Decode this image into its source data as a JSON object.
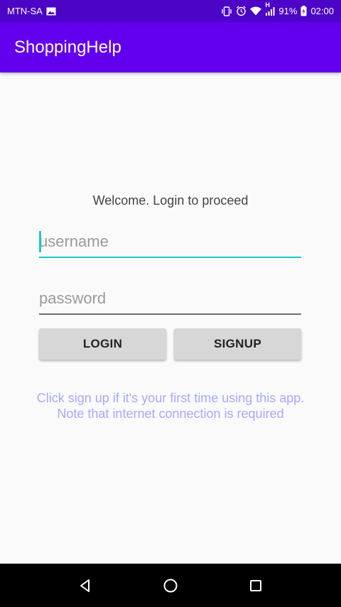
{
  "status_bar": {
    "carrier": "MTN-SA",
    "battery_percent": "91%",
    "time": "02:00",
    "network_type": "H",
    "icons": [
      "image-icon",
      "vibrate-icon",
      "alarm-icon",
      "wifi-icon",
      "signal-icon",
      "battery-charging-icon"
    ]
  },
  "app_bar": {
    "title": "ShoppingHelp",
    "color": "#6200ee"
  },
  "login": {
    "welcome_text": "Welcome. Login to proceed",
    "username_placeholder": "username",
    "password_placeholder": "password",
    "login_label": "LOGIN",
    "signup_label": "SIGNUP",
    "hint_line1": "Click sign up if it's your first time using this app.",
    "hint_line2": "Note that internet connection is required",
    "accent_color": "#1ec8c8",
    "hint_color": "#a9a7ff"
  },
  "nav_bar": {
    "icons": [
      "back-icon",
      "home-icon",
      "recents-icon"
    ]
  }
}
